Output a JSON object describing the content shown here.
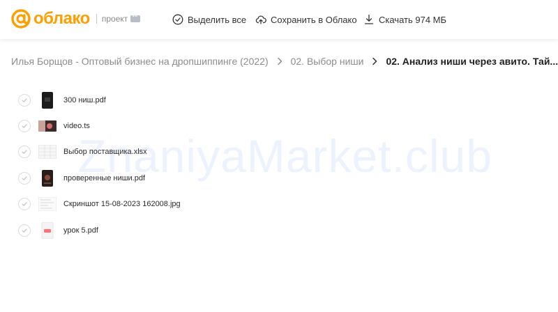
{
  "brand": {
    "name": "облако",
    "sub": "проект"
  },
  "toolbar": {
    "select_all": "Выделить все",
    "save_to_cloud": "Сохранить в Облако",
    "download": "Скачать 974 МБ"
  },
  "breadcrumbs": {
    "root": "Илья Борщов - Оптовый бизнес на дропшиппинге (2022)",
    "folder": "02. Выбор ниши",
    "current": "02. Анализ ниши через авито. Тай..."
  },
  "watermark": "ZnaniyaMarket.club",
  "files": [
    {
      "name": "300 ниш.pdf",
      "icon": "pdf-dark-thumbnail"
    },
    {
      "name": "video.ts",
      "icon": "video-thumbnail"
    },
    {
      "name": "Выбор поставщика.xlsx",
      "icon": "spreadsheet-thumbnail"
    },
    {
      "name": "проверенные ниши.pdf",
      "icon": "pdf-book-thumbnail"
    },
    {
      "name": "Скриншот 15-08-2023 162008.jpg",
      "icon": "screenshot-thumbnail"
    },
    {
      "name": "урок 5.pdf",
      "icon": "pdf-file-icon"
    }
  ],
  "colors": {
    "brand_orange": "#ff9e00",
    "muted_text": "#8c8c8c"
  }
}
